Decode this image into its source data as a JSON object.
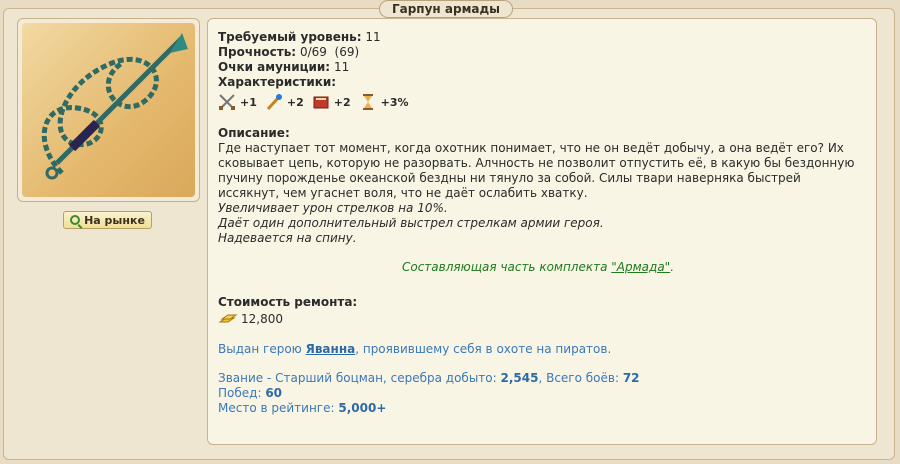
{
  "window": {
    "title": "Гарпун армады"
  },
  "left": {
    "market_button": "На рынке"
  },
  "info": {
    "required_level_label": "Требуемый уровень:",
    "required_level": "11",
    "durability_label": "Прочность:",
    "durability": "0/69  (69)",
    "ammo_label": "Очки амуниции:",
    "ammo": "11",
    "stats_label": "Характеристики:",
    "stats": [
      {
        "icon": "attack-icon",
        "value": "+1"
      },
      {
        "icon": "initiative-icon",
        "value": "+2"
      },
      {
        "icon": "book-icon",
        "value": "+2"
      },
      {
        "icon": "hourglass-icon",
        "value": "+3%"
      }
    ]
  },
  "description": {
    "label": "Описание:",
    "text": "Где наступает тот момент, когда охотник понимает, что не он ведёт добычу, а она ведёт его? Их сковывает цепь, которую не разорвать. Алчность не позволит отпустить её, в какую бы бездонную пучину порожденье океанской бездны ни тянуло за собой. Силы твари наверняка быстрей иссякнут, чем угаснет воля, что не даёт ослабить хватку.",
    "effect1": "Увеличивает урон стрелков на 10%.",
    "effect2": "Даёт один дополнительный выстрел стрелкам армии героя.",
    "effect3": "Надевается на спину.",
    "set_prefix": "Составляющая часть комплекта ",
    "set_name": "\"Армада\"",
    "set_suffix": "."
  },
  "repair": {
    "label": "Стоимость ремонта:",
    "cost": "12,800"
  },
  "owner": {
    "prefix": "Выдан герою ",
    "hero": "Яванна",
    "suffix": ", проявившему себя в охоте на пиратов."
  },
  "rank": {
    "text1": "Звание - Старший боцман, серебра добыто: ",
    "silver": "2,545",
    "text2": ", Всего боёв: ",
    "battles": "72",
    "wins_label": "Побед: ",
    "wins": "60",
    "rating_label": "Место в рейтинге: ",
    "rating": "5,000+"
  },
  "colors": {
    "link_blue": "#2d6aa8",
    "set_green": "#1f7a1f",
    "background": "#e8dcc4"
  }
}
